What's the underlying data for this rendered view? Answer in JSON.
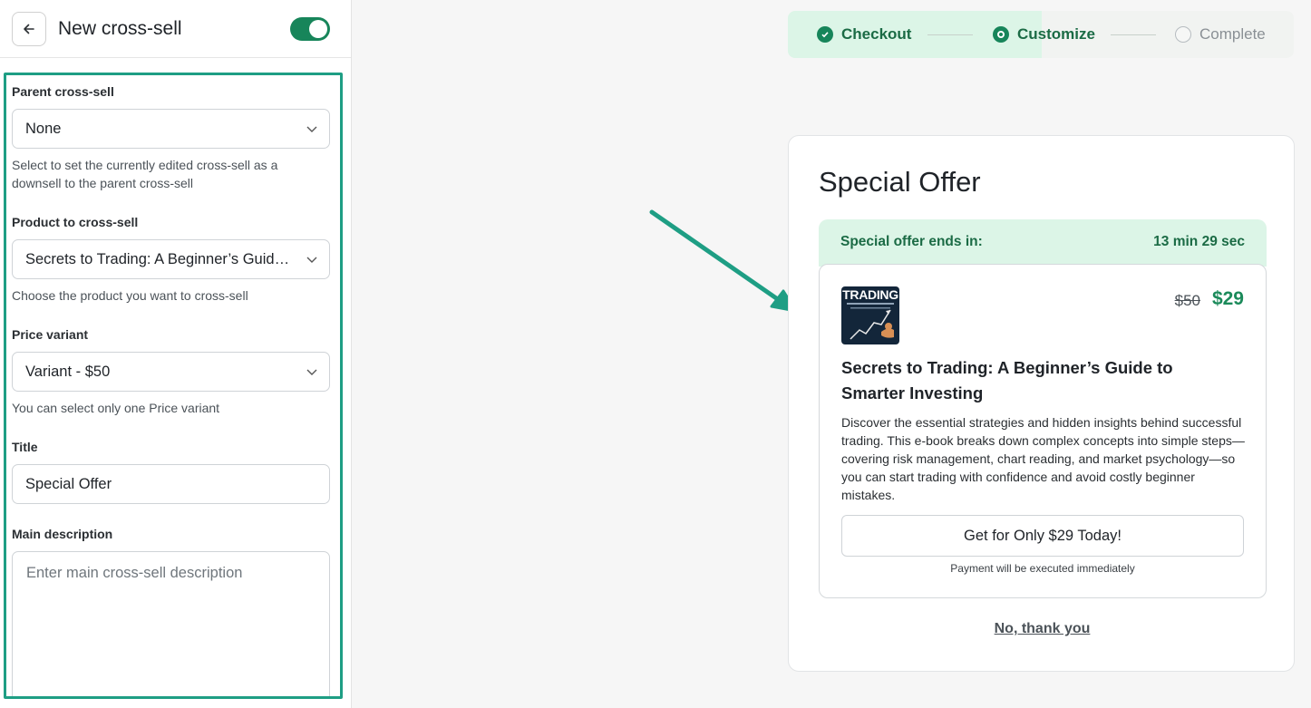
{
  "header": {
    "title": "New cross-sell",
    "back_icon": "arrow-left-icon",
    "toggle_on": true
  },
  "form": {
    "parent": {
      "label": "Parent cross-sell",
      "value": "None",
      "help": "Select to set the currently edited cross-sell as a downsell to the parent cross-sell"
    },
    "product": {
      "label": "Product to cross-sell",
      "value": "Secrets to Trading: A Beginner’s Guide …",
      "help": "Choose the product you want to cross-sell"
    },
    "price_variant": {
      "label": "Price variant",
      "value": "Variant - $50",
      "help": "You can select only one Price variant"
    },
    "title": {
      "label": "Title",
      "value": "Special Offer"
    },
    "main_description": {
      "label": "Main description",
      "placeholder": "Enter main cross-sell description"
    }
  },
  "stepper": {
    "steps": [
      {
        "label": "Checkout",
        "state": "done"
      },
      {
        "label": "Customize",
        "state": "current"
      },
      {
        "label": "Complete",
        "state": "pending"
      }
    ]
  },
  "preview": {
    "title": "Special Offer",
    "timer_label": "Special offer ends in:",
    "timer_value": "13 min 29 sec",
    "product_image_text": "TRADING",
    "price_old": "$50",
    "price_new": "$29",
    "product_name": "Secrets to Trading: A Beginner’s Guide to Smarter Investing",
    "product_description": "Discover the essential strategies and hidden insights behind successful trading. This e-book breaks down complex concepts into simple steps—covering risk management, chart reading, and market psychology—so you can start trading with confidence and avoid costly beginner mistakes.",
    "buy_button": "Get for Only $29 Today!",
    "payment_note": "Payment will be executed immediately",
    "decline_link": "No, thank you"
  },
  "colors": {
    "accent_green": "#17855a",
    "highlight_frame": "#1e9e84",
    "step_done_bg": "#dcf5e7",
    "price_green": "#1b8a5a"
  }
}
